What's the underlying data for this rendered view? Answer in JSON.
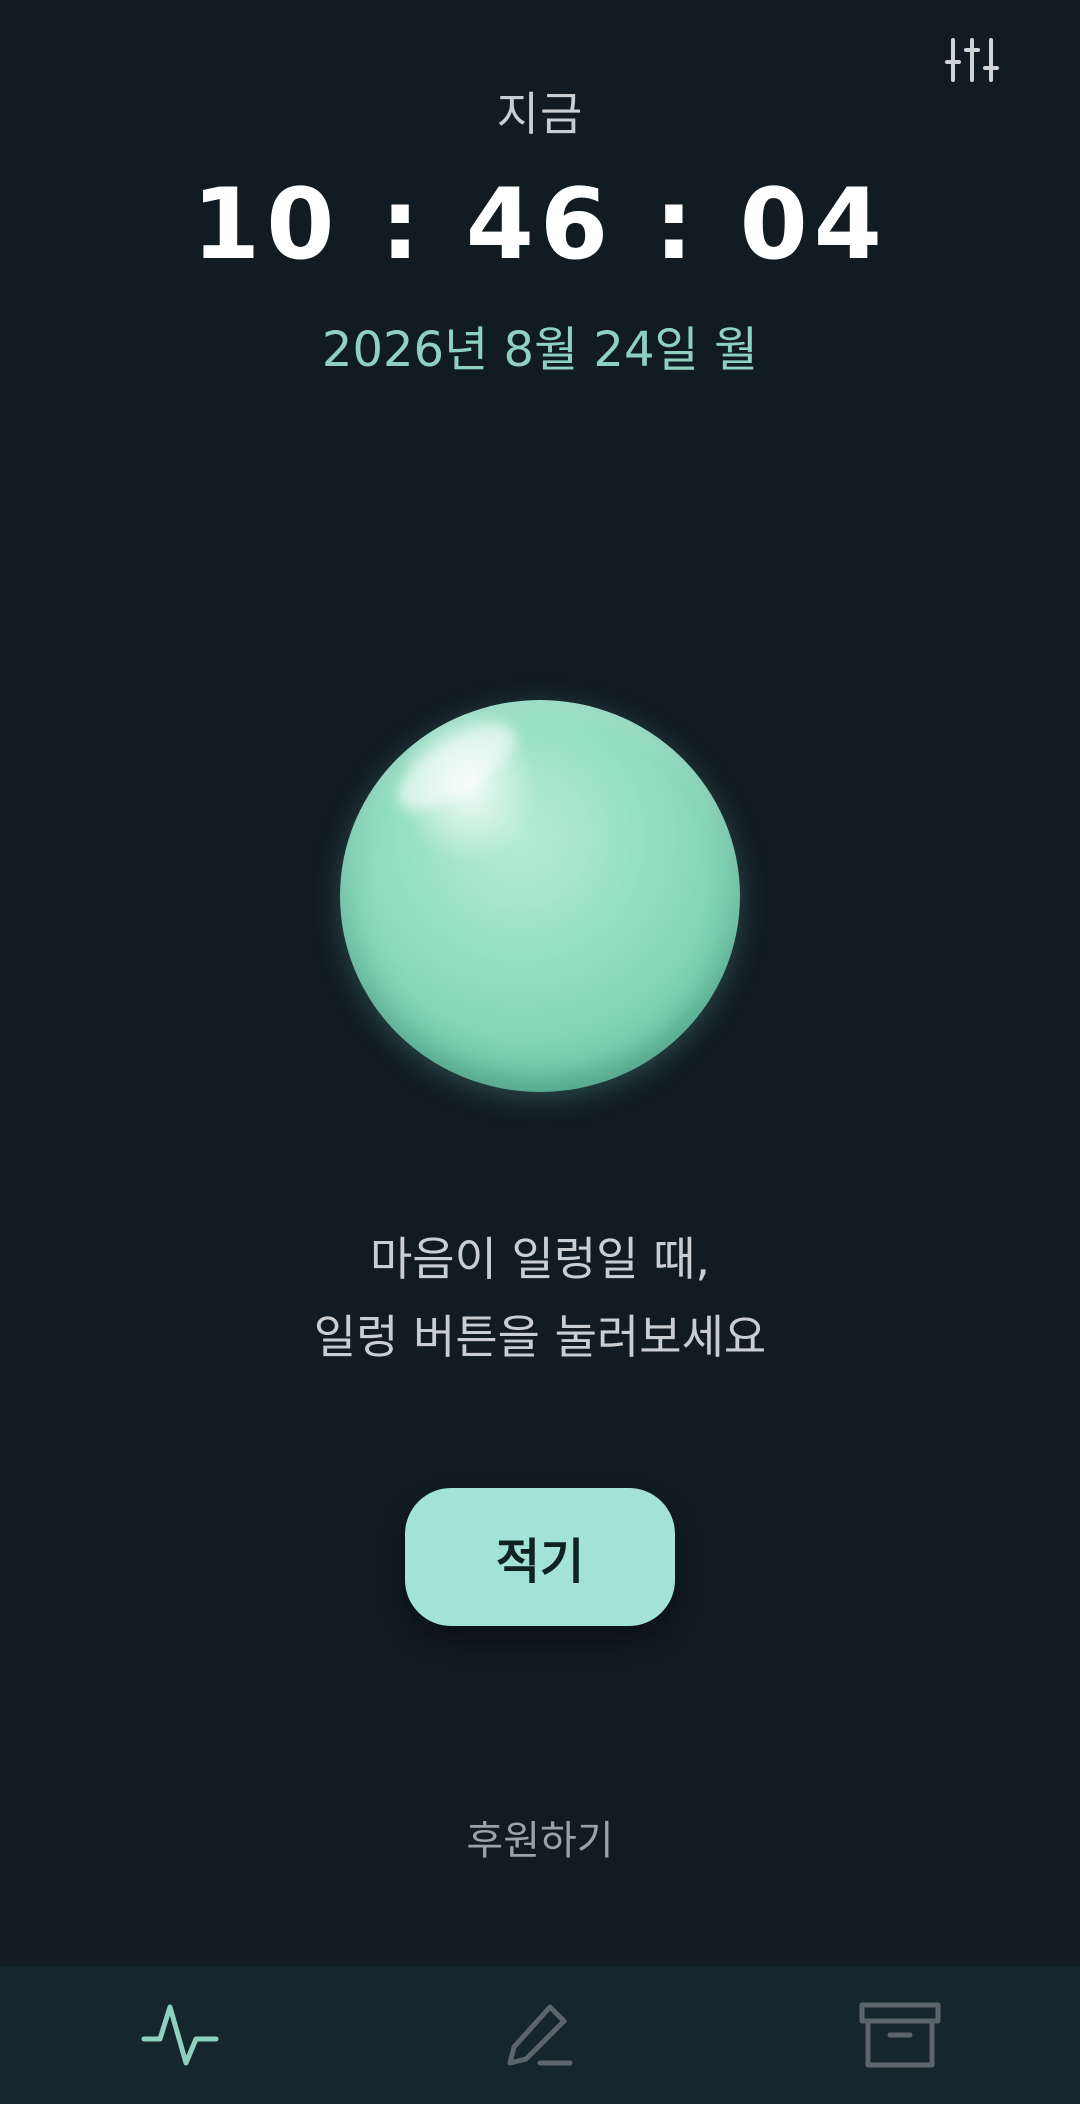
{
  "header": {
    "settings_icon": "sliders-icon",
    "now_label": "지금"
  },
  "clock": {
    "time": "10 : 46 : 04",
    "date": "2026년 8월 24일 월"
  },
  "main": {
    "message_line1": "마음이 일렁일 때,",
    "message_line2": "일렁 버튼을 눌러보세요",
    "write_button_label": "적기",
    "donate_link": "후원하기"
  },
  "bottom_nav": {
    "items": [
      {
        "icon": "activity-icon",
        "active": true
      },
      {
        "icon": "pencil-icon",
        "active": false
      },
      {
        "icon": "archive-icon",
        "active": false
      }
    ]
  },
  "colors": {
    "background": "#111b22",
    "accent": "#8fd1bf",
    "button": "#a3e3d6",
    "nav_background": "#15262e",
    "nav_inactive": "#5b656b"
  }
}
